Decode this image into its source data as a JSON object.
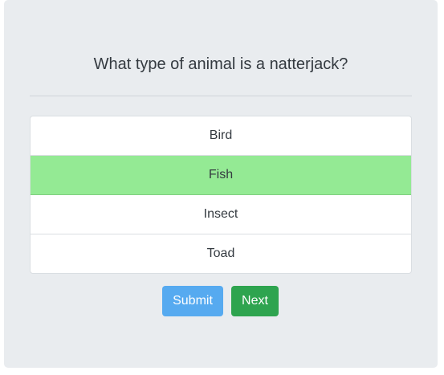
{
  "quiz": {
    "question": "What type of animal is a natterjack?",
    "answers": [
      {
        "label": "Bird",
        "selected": false
      },
      {
        "label": "Fish",
        "selected": true
      },
      {
        "label": "Insect",
        "selected": false
      },
      {
        "label": "Toad",
        "selected": false
      }
    ],
    "submit_label": "Submit",
    "next_label": "Next"
  },
  "colors": {
    "card_background": "#e9ecef",
    "selected_answer": "#94ea94",
    "submit_button": "#56aaf0",
    "next_button": "#2ea44f"
  }
}
